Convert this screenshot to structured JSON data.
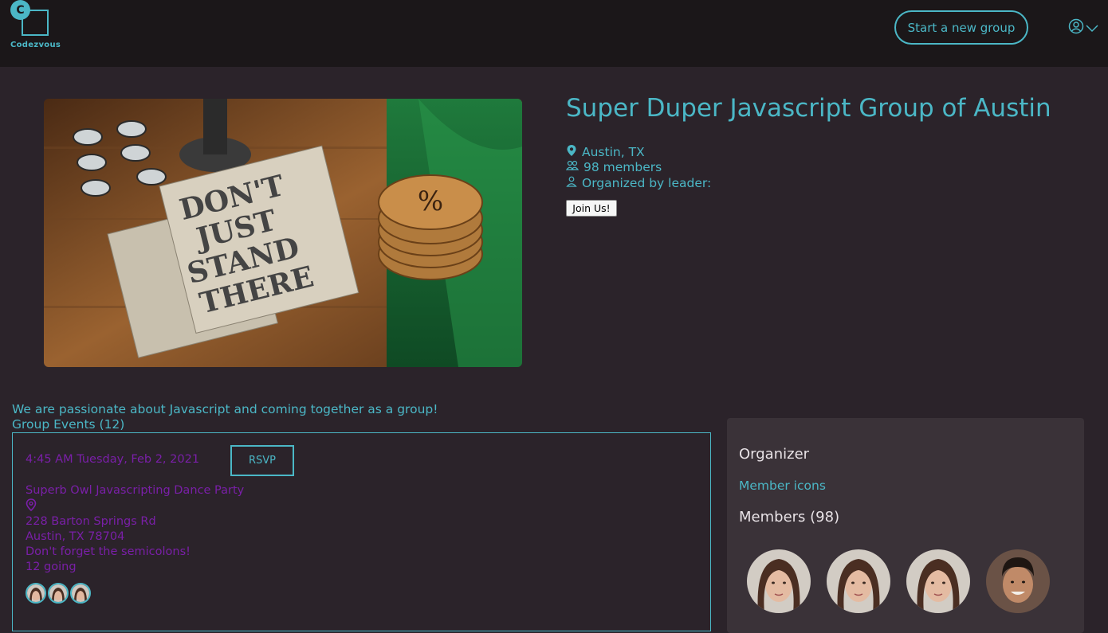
{
  "header": {
    "logo_letter": "C",
    "logo_text": "Codezvous",
    "new_group_label": "Start a new group"
  },
  "group": {
    "title": "Super Duper Javascript Group of Austin",
    "location": "Austin, TX",
    "members": "98 members",
    "organized_by": "Organized by leader:",
    "join_label": "Join Us!",
    "hero_notebook_text": [
      "DON'T",
      "JUST",
      "STAND",
      "THERE"
    ],
    "about": "We are passionate about Javascript and coming together as a group!"
  },
  "events": {
    "heading": "Group Events (12)",
    "items": [
      {
        "datetime": "4:45 AM Tuesday, Feb 2, 2021",
        "rsvp_label": "RSVP",
        "title": "Superb Owl Javascripting Dance Party",
        "address_line1": "228 Barton Springs Rd",
        "address_line2": "Austin, TX 78704",
        "description": "Don't forget the semicolons!",
        "going": "12 going"
      }
    ]
  },
  "sidebar": {
    "organizer_heading": "Organizer",
    "member_icons_link": "Member icons",
    "members_heading": "Members (98)"
  },
  "colors": {
    "accent": "#4bb7c6",
    "event_text": "#7a1fa8",
    "topbar": "#1b1719",
    "background": "#2b232a",
    "panel": "#3a3238"
  }
}
